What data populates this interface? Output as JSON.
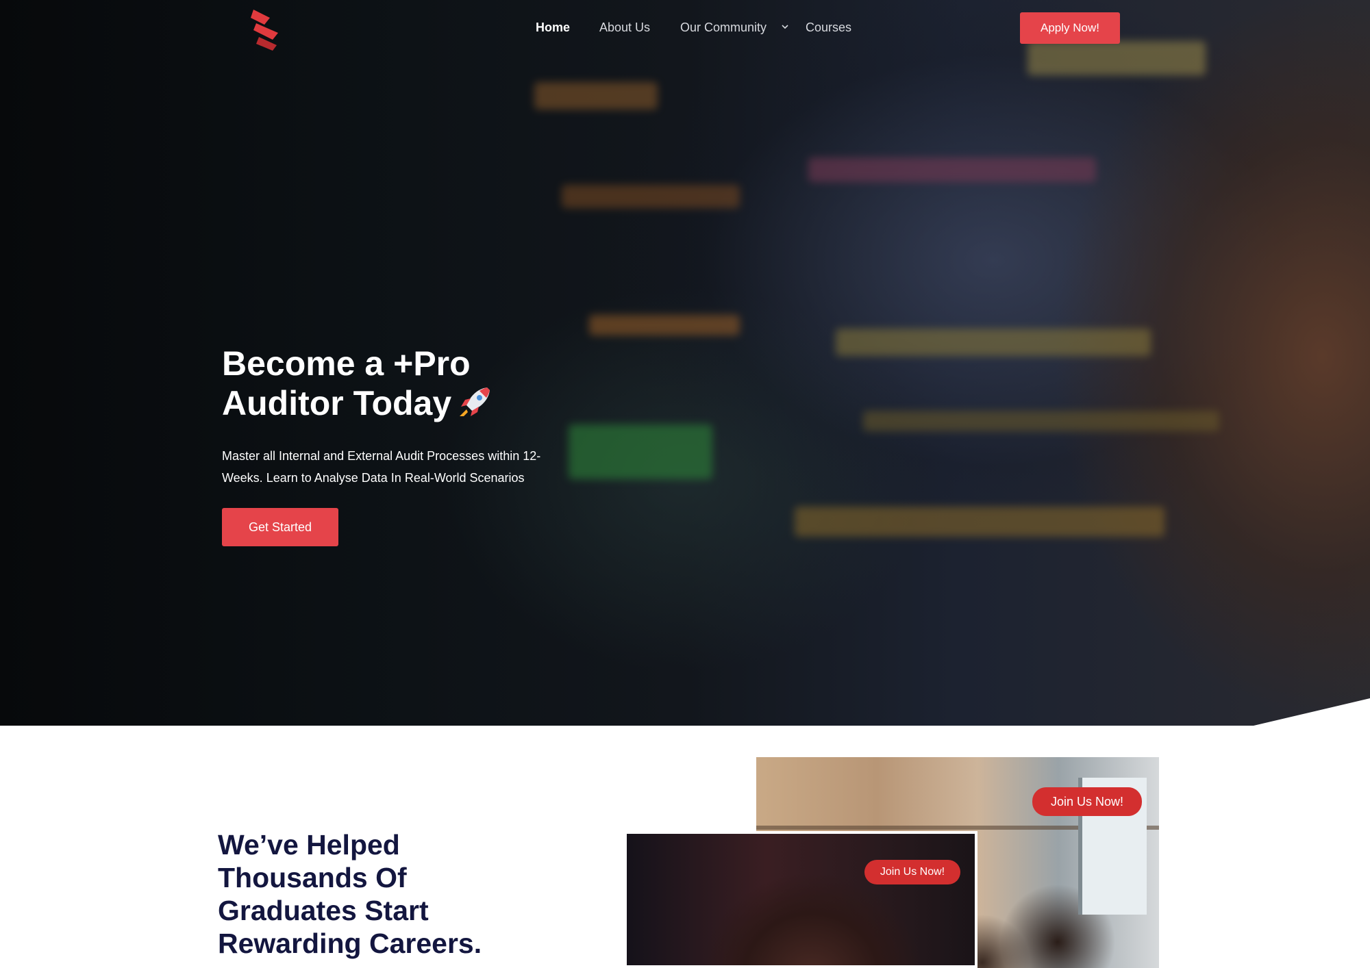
{
  "header": {
    "logo": "brand-logo-icon",
    "nav": [
      {
        "label": "Home",
        "active": true
      },
      {
        "label": "About Us",
        "active": false
      },
      {
        "label": "Our Community",
        "active": false,
        "has_dropdown": true
      },
      {
        "label": "Courses",
        "active": false
      }
    ],
    "apply_label": "Apply Now!"
  },
  "hero": {
    "title_line1": "Become a +Pro",
    "title_line2": "Auditor Today",
    "title_emoji": "rocket-icon",
    "subtitle_line1": "Master all Internal and External Audit Processes within 12-",
    "subtitle_line2": "Weeks. Learn to Analyse Data In Real-World Scenarios",
    "cta_label": "Get Started"
  },
  "section": {
    "title_lines": [
      "We’ve Helped",
      "Thousands Of",
      "Graduates Start",
      "Rewarding Careers."
    ],
    "badges": [
      "Join Us Now!",
      "Join Us Now!"
    ]
  },
  "colors": {
    "accent": "#e5444a",
    "badge": "#d32f2f",
    "heading_dark": "#13163f",
    "hero_bg": "#0b0f13"
  }
}
